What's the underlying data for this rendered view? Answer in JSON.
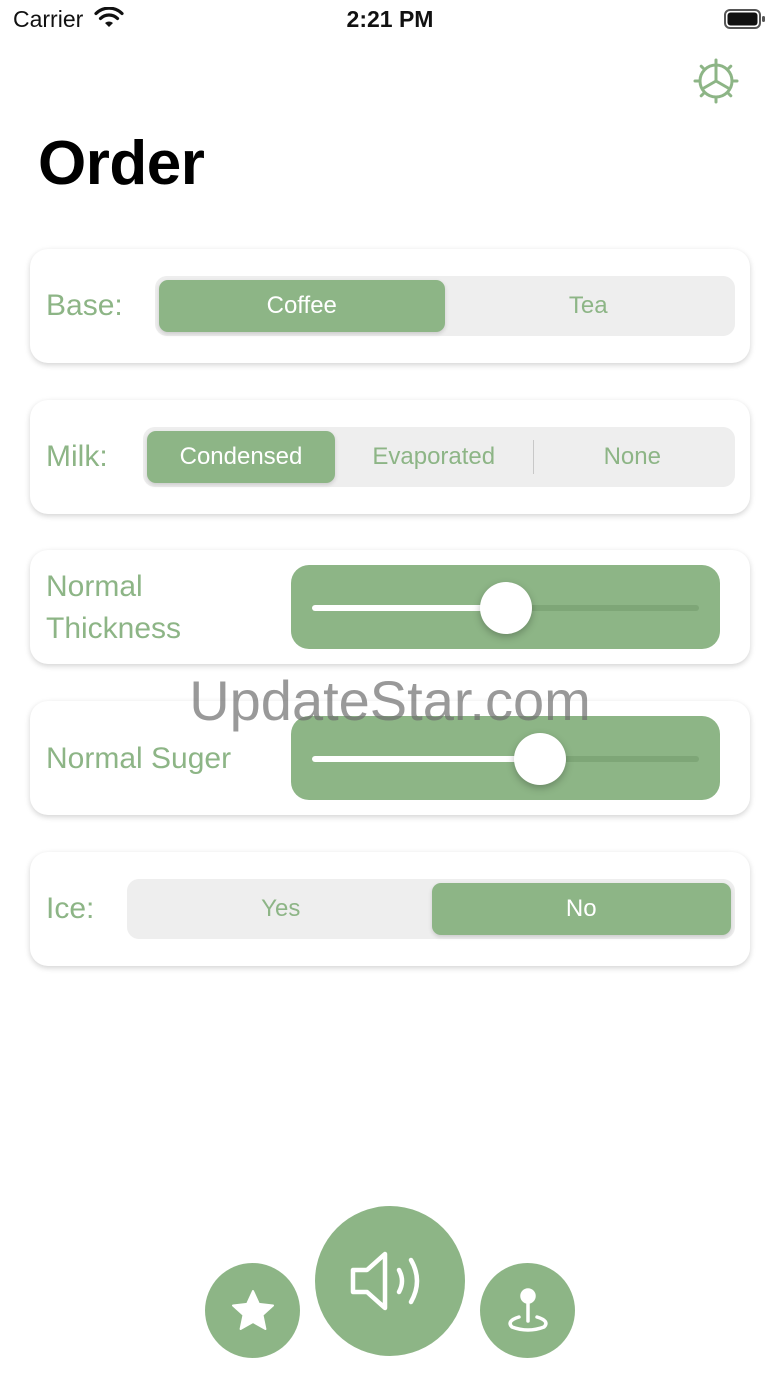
{
  "status_bar": {
    "carrier": "Carrier",
    "time": "2:21 PM"
  },
  "header": {
    "title": "Order"
  },
  "base": {
    "label": "Base:",
    "options": [
      "Coffee",
      "Tea"
    ],
    "selected": "Coffee"
  },
  "milk": {
    "label": "Milk:",
    "options": [
      "Condensed",
      "Evaporated",
      "None"
    ],
    "selected": "Condensed"
  },
  "thickness": {
    "label": "Normal Thickness",
    "value": 0.5
  },
  "sugar": {
    "label": "Normal Suger",
    "value": 0.59
  },
  "ice": {
    "label": "Ice:",
    "options": [
      "Yes",
      "No"
    ],
    "selected": "No"
  },
  "watermark": "UpdateStar.com",
  "toolbar": {
    "left_icon": "star-icon",
    "center_icon": "speaker-icon",
    "right_icon": "map-pin-icon"
  },
  "colors": {
    "accent": "#8db586",
    "segment_bg": "#eeeeee"
  }
}
